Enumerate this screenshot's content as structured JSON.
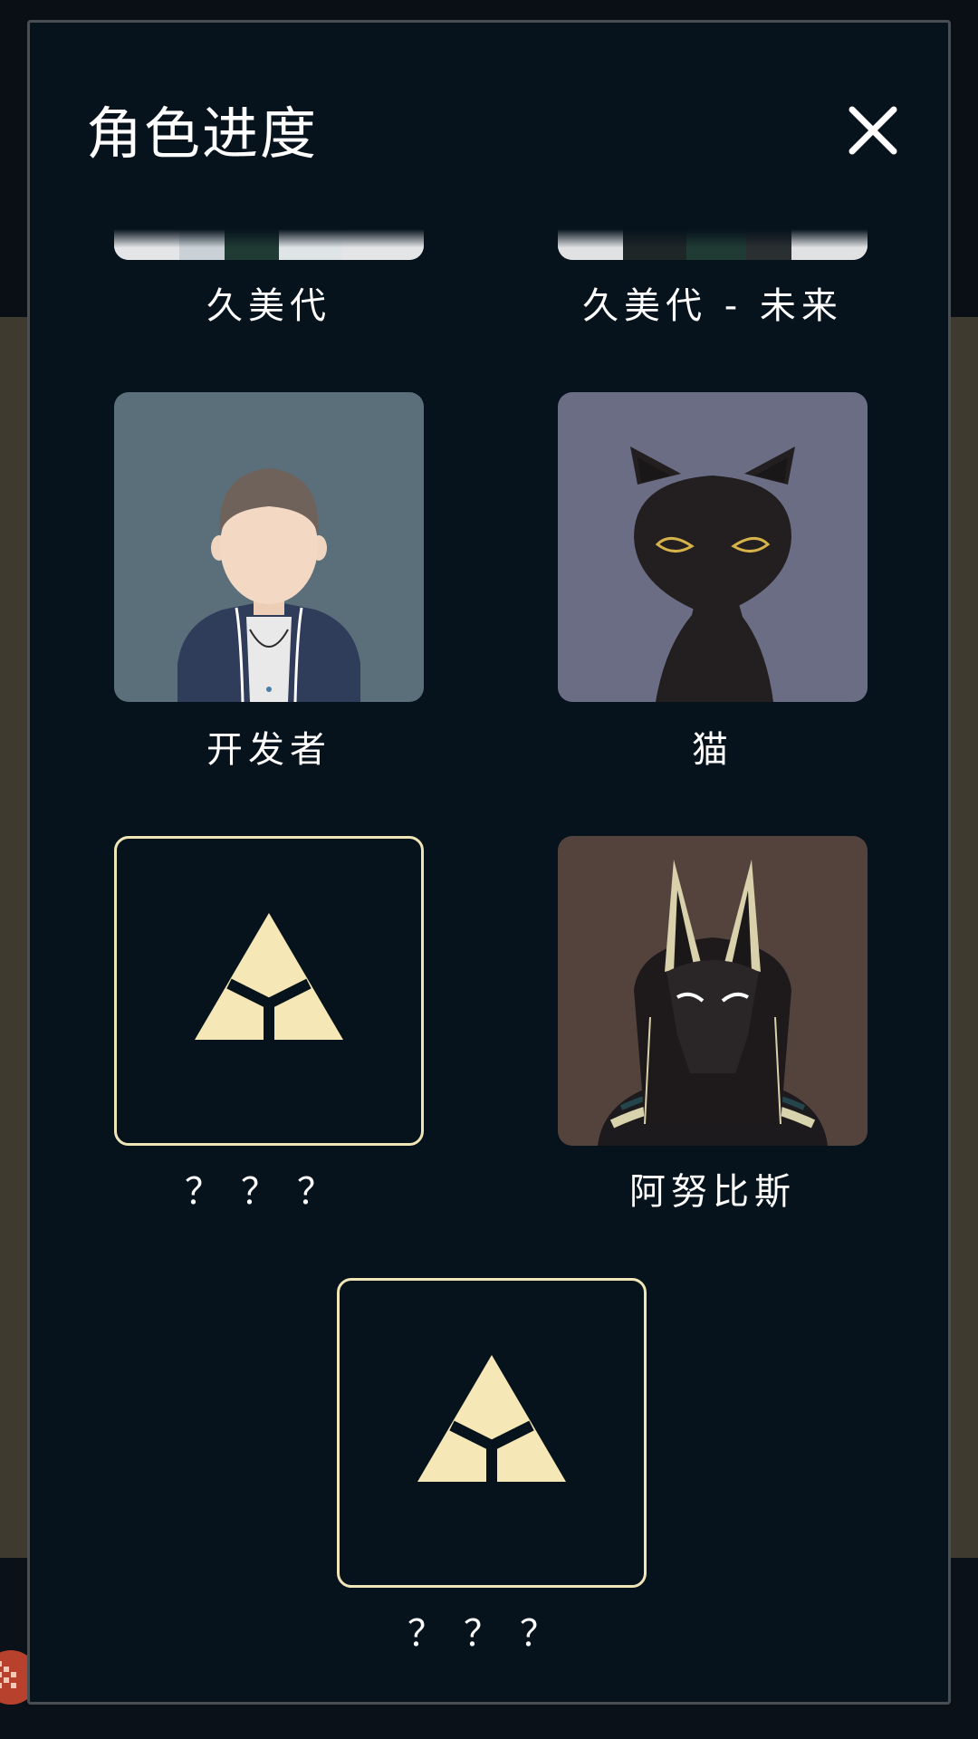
{
  "panel": {
    "title": "角色进度",
    "close_icon": "close-icon"
  },
  "characters": [
    {
      "label": "久美代",
      "state": "partial"
    },
    {
      "label": "久美代 - 未来",
      "state": "partial"
    },
    {
      "label": "开发者",
      "state": "unlocked",
      "bg": "#5b6f7b"
    },
    {
      "label": "猫",
      "state": "unlocked",
      "bg": "#6b6d85"
    },
    {
      "label": "？？？",
      "state": "locked",
      "icon": "triangle-emblem-icon"
    },
    {
      "label": "阿努比斯",
      "state": "unlocked",
      "bg": "#54433d"
    },
    {
      "label": "？？？",
      "state": "locked",
      "icon": "triangle-emblem-icon"
    }
  ],
  "colors": {
    "panel_bg": "#06121c",
    "locked_border": "#efe5b7",
    "emblem": "#f6e8b6"
  }
}
